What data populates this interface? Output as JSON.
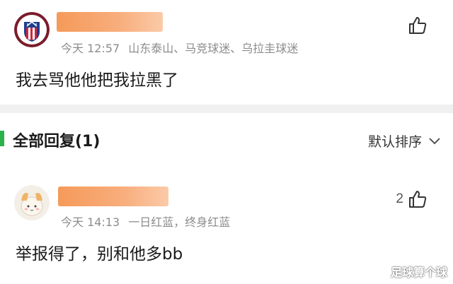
{
  "main_comment": {
    "avatar": "atletico-madrid-crest",
    "time": "今天 12:57",
    "tags": "山东泰山、马竞球迷、乌拉圭球迷",
    "text": "我去骂他他把我拉黑了",
    "like_icon": "thumbs-up-icon"
  },
  "replies": {
    "title": "全部回复(1)",
    "sort_label": "默认排序",
    "sort_icon": "chevron-down-icon",
    "accent_color": "#2bb24c"
  },
  "reply_comment": {
    "avatar": "cartoon-avatar",
    "time": "今天 14:13",
    "tags": "一日红蓝，终身红蓝",
    "text": "举报得了，别和他多bb",
    "like_count": "2",
    "like_icon": "thumbs-up-icon"
  },
  "watermark": "足球算个球",
  "colors": {
    "name_redaction": "#f59a5a",
    "meta_text": "#8c8c8c",
    "divider": "#f0f0f0"
  }
}
